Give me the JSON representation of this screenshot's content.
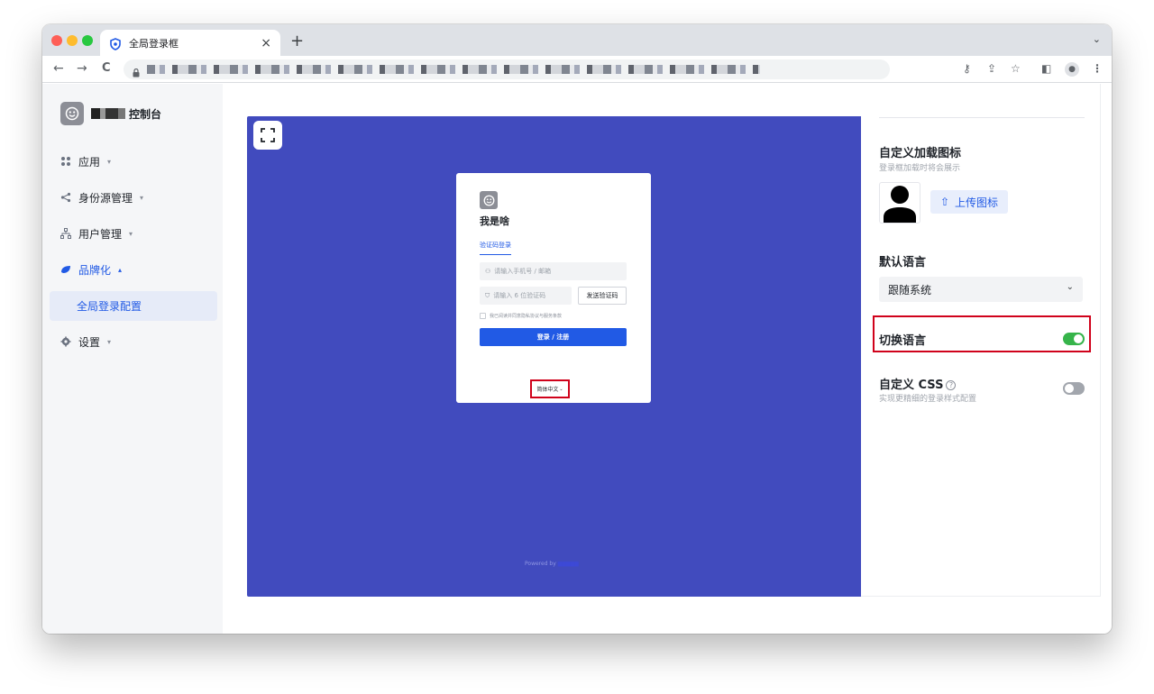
{
  "browser": {
    "tab_title": "全局登录框",
    "close_glyph": "×",
    "new_tab_glyph": "+",
    "menu_glyph": "⌄",
    "back_glyph": "←",
    "forward_glyph": "→",
    "reload_glyph": "C",
    "key_glyph": "⚷",
    "share_glyph": "⇪",
    "star_glyph": "☆",
    "sidepanel_glyph": "◧",
    "profile_glyph": "●",
    "more_glyph": "⋮"
  },
  "sidebar": {
    "brand_suffix": "控制台",
    "items": [
      {
        "label": "应用",
        "icon": "apps-icon"
      },
      {
        "label": "身份源管理",
        "icon": "share-icon"
      },
      {
        "label": "用户管理",
        "icon": "org-icon"
      },
      {
        "label": "品牌化",
        "icon": "brand-icon"
      },
      {
        "label": "设置",
        "icon": "gear-icon"
      }
    ],
    "sub_item": "全局登录配置",
    "caret_down": "▾",
    "caret_up": "▴"
  },
  "preview": {
    "app_name": "我是啥",
    "tab_label": "验证码登录",
    "phone_placeholder": "请输入手机号 / 邮箱",
    "code_placeholder": "请输入 6 位验证码",
    "send_code": "发送验证码",
    "agreement": "我已阅读并同意隐私协议与服务条款",
    "login_button": "登录 / 注册",
    "language": "简体中文",
    "language_chevron": "⌄",
    "powered_by": "Powered by",
    "user_glyph": "⚇",
    "shield_glyph": "⛉"
  },
  "settings": {
    "loading_icon_title": "自定义加载图标",
    "loading_icon_desc": "登录框加载时将会展示",
    "upload_label": "上传图标",
    "upload_glyph": "⇧",
    "default_language_title": "默认语言",
    "default_language_value": "跟随系统",
    "select_chevron": "⌄",
    "switch_language_title": "切换语言",
    "switch_language_on": true,
    "custom_css_title": "自定义 CSS",
    "custom_css_help": "?",
    "custom_css_desc": "实现更精细的登录样式配置",
    "custom_css_on": false
  },
  "colors": {
    "accent": "#215ae5",
    "preview_bg": "#414bbe",
    "toggle_on": "#36b44a",
    "highlight": "#d0021b"
  }
}
